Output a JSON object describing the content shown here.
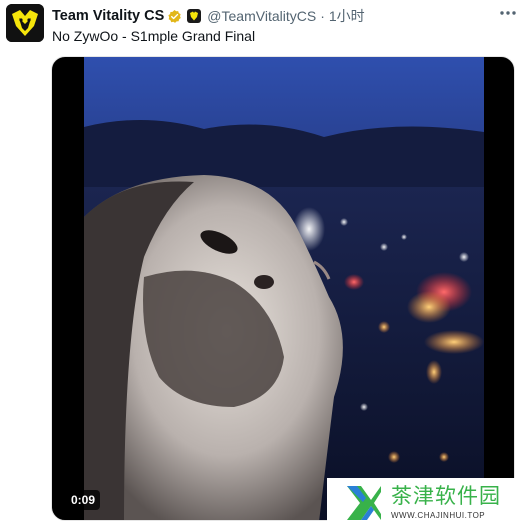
{
  "tweet": {
    "author_name": "Team Vitality CS",
    "handle": "@TeamVitalityCS",
    "separator": "·",
    "time": "1小时",
    "text": "No ZywOo - S1mple Grand Final"
  },
  "icons": {
    "avatar": "team-vitality-bee-logo",
    "verified": "gold-verified-badge",
    "affiliate": "affiliate-badge",
    "more": "more-options-icon"
  },
  "video": {
    "duration": "0:09"
  },
  "watermark": {
    "title": "茶津软件园",
    "url": "WWW.CHAJINHUI.TOP"
  },
  "colors": {
    "verified_gold": "#e2b719",
    "vitality_yellow": "#f5e50b",
    "watermark_green": "#38b24a",
    "secondary_text": "#536471"
  }
}
